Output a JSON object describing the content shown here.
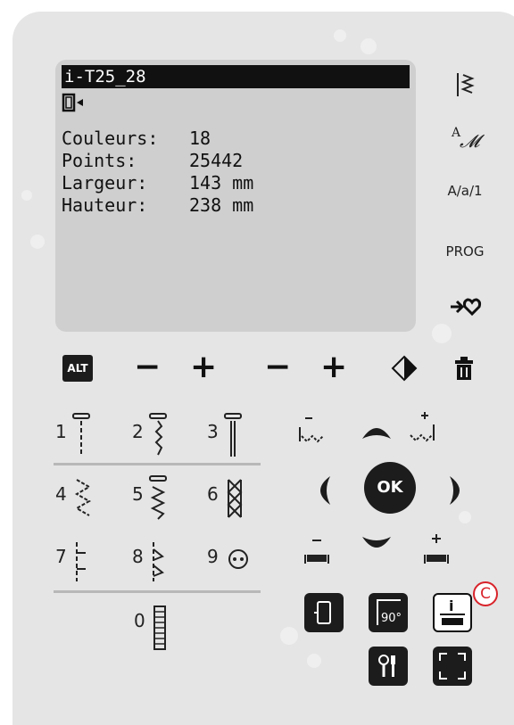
{
  "screen": {
    "title": "i-T25_28",
    "rows": [
      {
        "label": "Couleurs:",
        "value": "18"
      },
      {
        "label": "Points:",
        "value": "25442"
      },
      {
        "label": "Largeur:",
        "value": "143 mm"
      },
      {
        "label": "Hauteur:",
        "value": "238 mm"
      }
    ]
  },
  "side_buttons": {
    "case_label": "A/a/1",
    "prog_label": "PROG"
  },
  "top_row": {
    "alt_label": "ALT",
    "minus1": "−",
    "plus1": "+",
    "minus2": "−",
    "plus2": "+"
  },
  "stitches": [
    "1",
    "2",
    "3",
    "4",
    "5",
    "6",
    "7",
    "8",
    "9",
    "0"
  ],
  "nav": {
    "ok_label": "OK"
  },
  "callout": "C",
  "colors": {
    "panel": "#e5e5e5",
    "lcd": "#cfcfcf",
    "button_dark": "#1c1c1c",
    "callout": "#d8232a"
  },
  "icons": [
    "settings-tools-icon",
    "fullscreen-icon",
    "info-presser-icon",
    "rotate-90-icon",
    "hoop-icon"
  ]
}
